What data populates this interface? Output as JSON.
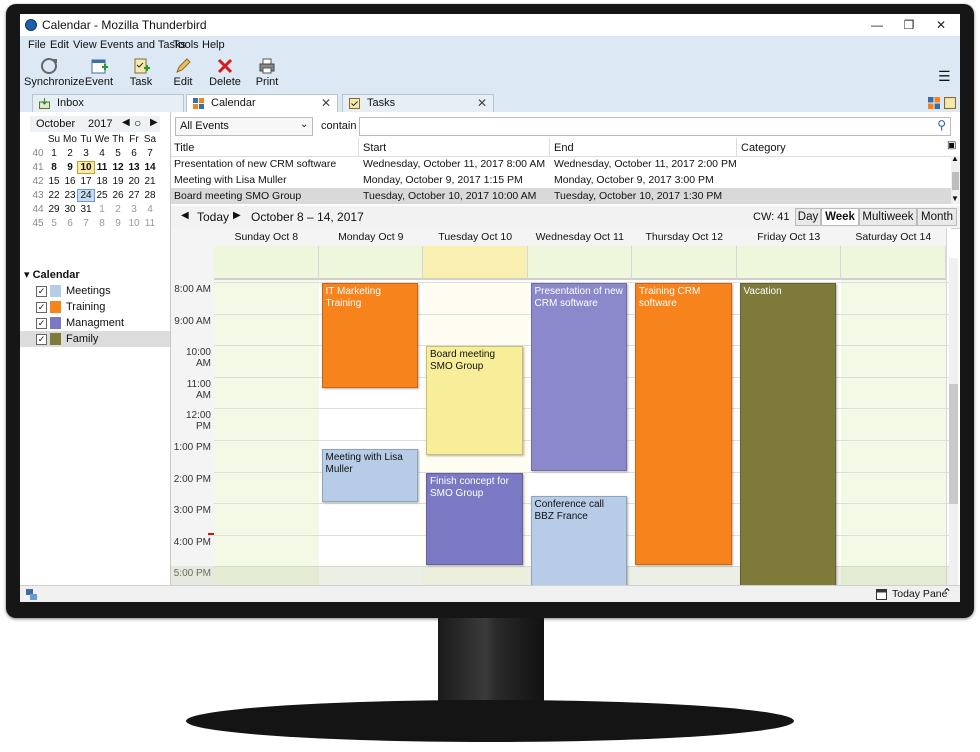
{
  "window": {
    "title": "Calendar - Mozilla Thunderbird"
  },
  "menu": [
    "File",
    "Edit",
    "View",
    "Events and Tasks",
    "Tools",
    "Help"
  ],
  "toolbar": {
    "synchronize": "Synchronize",
    "event": "Event",
    "task": "Task",
    "edit": "Edit",
    "delete": "Delete",
    "print": "Print"
  },
  "tabs": [
    {
      "label": "Inbox"
    },
    {
      "label": "Calendar"
    },
    {
      "label": "Tasks"
    }
  ],
  "minical": {
    "month": "October",
    "year": "2017",
    "weekdays": [
      "Su",
      "Mo",
      "Tu",
      "We",
      "Th",
      "Fr",
      "Sa"
    ],
    "weeks": [
      {
        "num": "40",
        "days": [
          "1",
          "2",
          "3",
          "4",
          "5",
          "6",
          "7"
        ]
      },
      {
        "num": "41",
        "days": [
          "8",
          "9",
          "10",
          "11",
          "12",
          "13",
          "14"
        ]
      },
      {
        "num": "42",
        "days": [
          "15",
          "16",
          "17",
          "18",
          "19",
          "20",
          "21"
        ]
      },
      {
        "num": "43",
        "days": [
          "22",
          "23",
          "24",
          "25",
          "26",
          "27",
          "28"
        ]
      },
      {
        "num": "44",
        "days": [
          "29",
          "30",
          "31",
          "1",
          "2",
          "3",
          "4"
        ]
      },
      {
        "num": "45",
        "days": [
          "5",
          "6",
          "7",
          "8",
          "9",
          "10",
          "11"
        ]
      }
    ]
  },
  "calendars": {
    "header": "Calendar",
    "items": [
      {
        "name": "Meetings",
        "color": "#b7cce6"
      },
      {
        "name": "Training",
        "color": "#f7831c"
      },
      {
        "name": "Managment",
        "color": "#7b79c4"
      },
      {
        "name": "Family",
        "color": "#7d7a3a"
      }
    ]
  },
  "filter": {
    "scope": "All Events",
    "mode": "contain",
    "query": ""
  },
  "event_list": {
    "columns": [
      "Title",
      "Start",
      "End",
      "Category"
    ],
    "rows": [
      {
        "title": "Presentation of new CRM software",
        "start": "Wednesday, October 11, 2017 8:00 AM",
        "end": "Wednesday, October 11, 2017 2:00 PM"
      },
      {
        "title": "Meeting with Lisa Muller",
        "start": "Monday, October 9, 2017 1:15 PM",
        "end": "Monday, October 9, 2017 3:00 PM"
      },
      {
        "title": "Board meeting SMO Group",
        "start": "Tuesday, October 10, 2017 10:00 AM",
        "end": "Tuesday, October 10, 2017 1:30 PM"
      }
    ]
  },
  "nav": {
    "today": "Today",
    "range": "October 8 – 14, 2017",
    "cw": "CW: 41",
    "views": [
      "Day",
      "Week",
      "Multiweek",
      "Month"
    ]
  },
  "week": {
    "days": [
      "Sunday Oct 8",
      "Monday Oct 9",
      "Tuesday Oct 10",
      "Wednesday Oct 11",
      "Thursday Oct 12",
      "Friday Oct 13",
      "Saturday Oct 14"
    ],
    "hours": [
      "8:00 AM",
      "9:00 AM",
      "10:00 AM",
      "11:00 AM",
      "12:00 PM",
      "1:00 PM",
      "2:00 PM",
      "3:00 PM",
      "4:00 PM",
      "5:00 PM"
    ],
    "events": [
      {
        "title": "IT Marketing Training",
        "day": 1,
        "start": 8.0,
        "end": 11.4,
        "color": "#f7831c",
        "text": "#fff"
      },
      {
        "title": "Meeting with Lisa Muller",
        "day": 1,
        "start": 13.25,
        "end": 15.0,
        "color": "#b7cce6",
        "text": "#111"
      },
      {
        "title": "Board meeting SMO Group",
        "day": 2,
        "start": 10.0,
        "end": 13.5,
        "color": "#f8ee9a",
        "text": "#111"
      },
      {
        "title": "Finish concept for SMO Group",
        "day": 2,
        "start": 14.0,
        "end": 17.0,
        "color": "#7b79c4",
        "text": "#fff"
      },
      {
        "title": "Presentation of new CRM software",
        "day": 3,
        "start": 8.0,
        "end": 14.0,
        "color": "#8b89cc",
        "text": "#fff"
      },
      {
        "title": "Conference call BBZ France",
        "day": 3,
        "start": 14.75,
        "end": 18.0,
        "color": "#b7cce6",
        "text": "#111"
      },
      {
        "title": "Training CRM software",
        "day": 4,
        "start": 8.0,
        "end": 17.0,
        "color": "#f7831c",
        "text": "#fff"
      },
      {
        "title": "Vacation",
        "day": 5,
        "start": 8.0,
        "end": 17.75,
        "color": "#7d7a3a",
        "text": "#fff"
      }
    ]
  },
  "status": {
    "today_pane": "Today Pane"
  }
}
